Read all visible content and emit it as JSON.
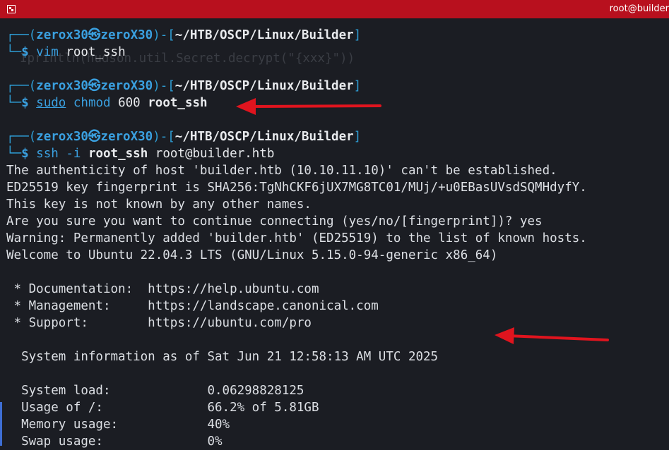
{
  "window": {
    "title": "root@builder"
  },
  "ghost_text": "Iprintln(hudson.util.Secret.decrypt(\"{xxx}\"))",
  "prompt": {
    "open": "┌──(",
    "user": "zerox30",
    "skull": "㉿",
    "host": "zeroX30",
    "mid": ")-[",
    "path": "~/HTB/OSCP/Linux/Builder",
    "close": "]",
    "corner": "└─",
    "dollar": "$"
  },
  "commands": [
    {
      "cmd": "vim",
      "args": "root_ssh"
    },
    {
      "sudo": "sudo",
      "cmd": "chmod",
      "arg1": "600",
      "arg2": "root_ssh"
    },
    {
      "cmd": "ssh",
      "flag": "-i",
      "key": "root_ssh",
      "target": "root@builder.htb"
    }
  ],
  "output": [
    "The authenticity of host 'builder.htb (10.10.11.10)' can't be established.",
    "ED25519 key fingerprint is SHA256:TgNhCKF6jUX7MG8TC01/MUj/+u0EBasUVsdSQMHdyfY.",
    "This key is not known by any other names.",
    "Are you sure you want to continue connecting (yes/no/[fingerprint])? yes",
    "Warning: Permanently added 'builder.htb' (ED25519) to the list of known hosts.",
    "Welcome to Ubuntu 22.04.3 LTS (GNU/Linux 5.15.0-94-generic x86_64)",
    " * Documentation:  https://help.ubuntu.com",
    " * Management:     https://landscape.canonical.com",
    " * Support:        https://ubuntu.com/pro",
    "  System information as of Sat Jun 21 12:58:13 AM UTC 2025",
    "  System load:             0.06298828125",
    "  Usage of /:              66.2% of 5.81GB",
    "  Memory usage:            40%",
    "  Swap usage:              0%"
  ],
  "colors": {
    "accent": "#b8101e",
    "arrow": "#e0141e",
    "prompt": "#2e9ed6",
    "background": "#1b1d23"
  }
}
